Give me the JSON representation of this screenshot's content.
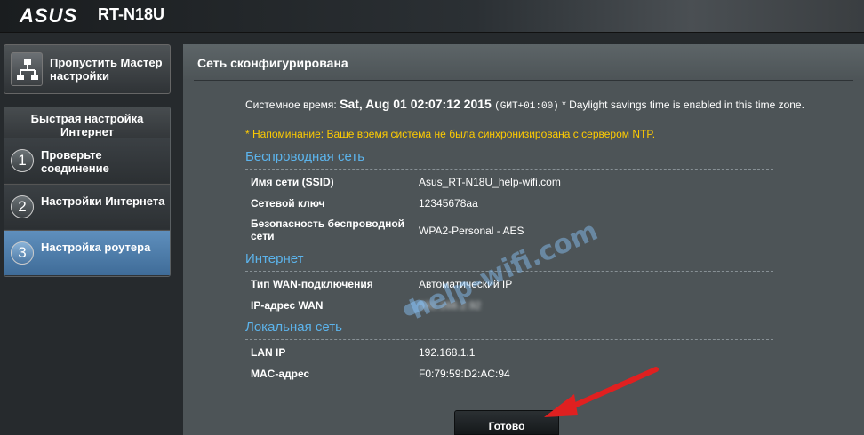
{
  "header": {
    "brand": "ASUS",
    "model": "RT-N18U"
  },
  "sidebar": {
    "skip_wizard_label": "Пропустить Мастер настройки",
    "quick_setup_title": "Быстрая настройка Интернет",
    "steps": [
      {
        "number": "1",
        "label": "Проверьте соединение",
        "active": false
      },
      {
        "number": "2",
        "label": "Настройки Интернета",
        "active": false
      },
      {
        "number": "3",
        "label": "Настройка роутера",
        "active": true
      }
    ]
  },
  "main": {
    "title": "Сеть сконфигурирована",
    "system_time": {
      "label": "Системное время:",
      "value": "Sat, Aug 01 02:07:12 2015",
      "gmt": "(GMT+01:00)",
      "dst_note": "* Daylight savings time is enabled in this time zone."
    },
    "warning": "* Напоминание: Ваше время система не была синхронизирована с сервером NTP.",
    "wireless": {
      "heading": "Беспроводная сеть",
      "ssid_label": "Имя сети (SSID)",
      "ssid_value": "Asus_RT-N18U_help-wifi.com",
      "key_label": "Сетевой ключ",
      "key_value": "12345678aa",
      "security_label": "Безопасность беспроводной сети",
      "security_value": "WPA2-Personal - AES"
    },
    "internet": {
      "heading": "Интернет",
      "wan_type_label": "Тип WAN-подключения",
      "wan_type_value": "Автоматический IP",
      "wan_ip_label": "IP-адрес WAN",
      "wan_ip_value": "192.168.2.92"
    },
    "lan": {
      "heading": "Локальная сеть",
      "lan_ip_label": "LAN IP",
      "lan_ip_value": "192.168.1.1",
      "mac_label": "MAC-адрес",
      "mac_value": "F0:79:59:D2:AC:94"
    },
    "done_button": "Готово",
    "watermark": "help-wifi.com"
  },
  "colors": {
    "section_heading": "#5cb4ec",
    "warning": "#ffcc00",
    "active_step": "#4f7fae",
    "arrow": "#e02020"
  }
}
